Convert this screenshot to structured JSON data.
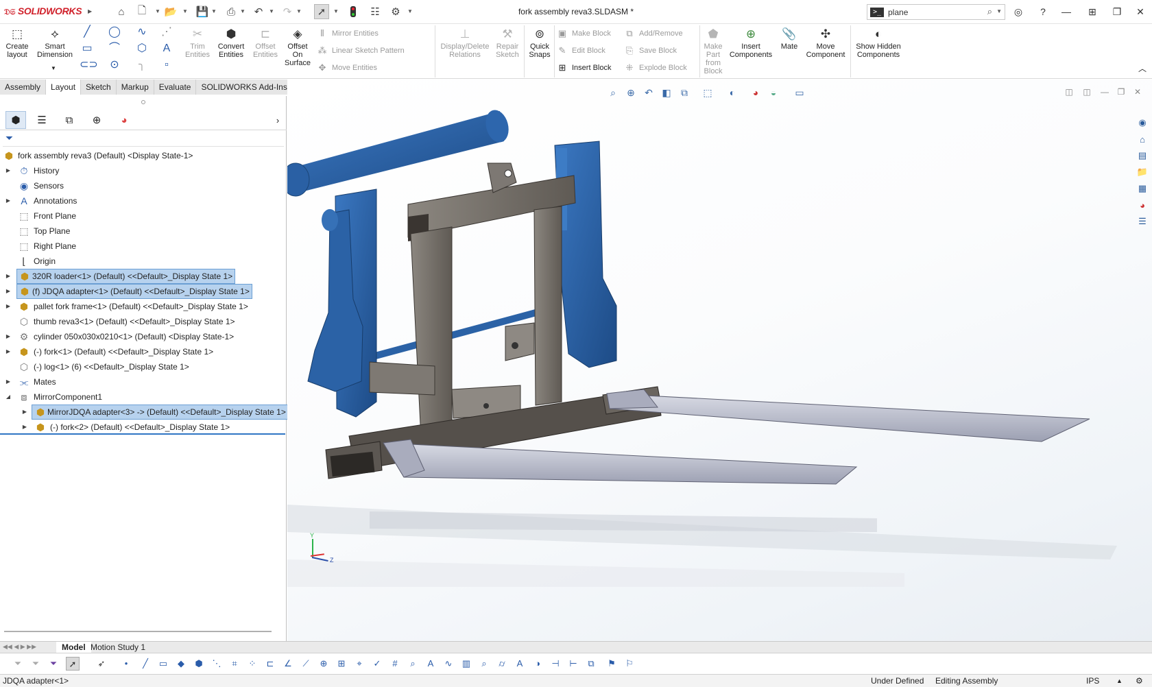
{
  "app": {
    "brand": "SOLIDWORKS",
    "window_title": "fork assembly reva3.SLDASM *",
    "search": {
      "value": "plane",
      "placeholder": ""
    }
  },
  "ribbon": {
    "create_layout": "Create layout",
    "smart_dimension": "Smart Dimension",
    "trim_entities": "Trim Entities",
    "convert_entities": "Convert Entities",
    "offset_entities": "Offset Entities",
    "offset_on_surface": "Offset On Surface",
    "mirror_entities": "Mirror Entities",
    "linear_sketch_pattern": "Linear Sketch Pattern",
    "move_entities": "Move Entities",
    "display_delete_relations": "Display/Delete Relations",
    "repair_sketch": "Repair Sketch",
    "quick_snaps": "Quick Snaps",
    "make_block": "Make Block",
    "edit_block": "Edit Block",
    "insert_block": "Insert Block",
    "add_remove": "Add/Remove",
    "save_block": "Save Block",
    "explode_block": "Explode Block",
    "make_part_from_block": "Make Part from Block",
    "insert_components": "Insert Components",
    "mate": "Mate",
    "move_component": "Move Component",
    "show_hidden_components": "Show Hidden Components"
  },
  "tabs": [
    "Assembly",
    "Layout",
    "Sketch",
    "Markup",
    "Evaluate",
    "SOLIDWORKS Add-Ins"
  ],
  "active_tab": "Layout",
  "tree": {
    "root": "fork assembly reva3 (Default) <Display State-1>",
    "items": [
      {
        "label": "History"
      },
      {
        "label": "Sensors"
      },
      {
        "label": "Annotations"
      },
      {
        "label": "Front Plane"
      },
      {
        "label": "Top Plane"
      },
      {
        "label": "Right Plane"
      },
      {
        "label": "Origin"
      },
      {
        "label": "320R loader<1> (Default) <<Default>_Display State 1>"
      },
      {
        "label": "(f) JDQA adapter<1> (Default) <<Default>_Display State 1>"
      },
      {
        "label": "pallet fork frame<1> (Default) <<Default>_Display State 1>"
      },
      {
        "label": "thumb reva3<1> (Default) <<Default>_Display State 1>"
      },
      {
        "label": "cylinder 050x030x0210<1> (Default) <Display State-1>"
      },
      {
        "label": "(-) fork<1> (Default) <<Default>_Display State 1>"
      },
      {
        "label": "(-) log<1> (6) <<Default>_Display State 1>"
      },
      {
        "label": "Mates"
      },
      {
        "label": "MirrorComponent1"
      },
      {
        "label": "MirrorJDQA adapter<3> -> (Default) <<Default>_Display State 1>"
      },
      {
        "label": "(-) fork<2> (Default) <<Default>_Display State 1>"
      }
    ]
  },
  "axes": {
    "y": "Y",
    "z": "Z"
  },
  "bottom_tabs": [
    "Model",
    "Motion Study 1"
  ],
  "status": {
    "left": "JDQA adapter<1>",
    "definition": "Under Defined",
    "mode": "Editing Assembly",
    "units": "IPS"
  },
  "colors": {
    "brand_red": "#d0202a",
    "selection": "#b7d2ee",
    "part_blue": "#2b62a6",
    "frame_gray": "#6c6862"
  }
}
